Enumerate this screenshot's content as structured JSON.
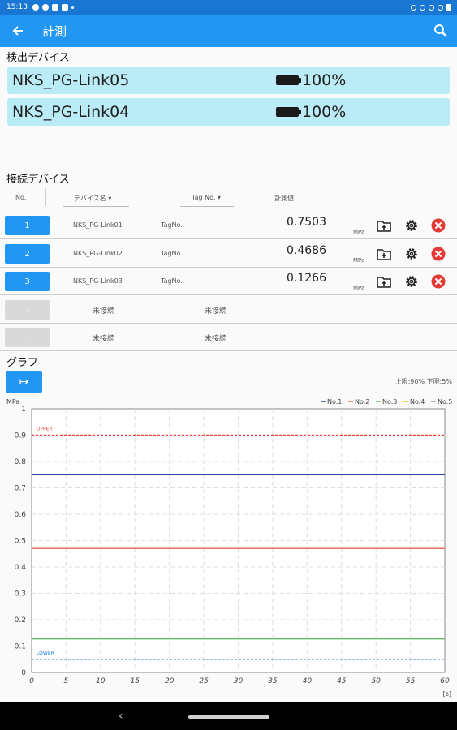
{
  "status_bar": {
    "time": "15:13"
  },
  "app_bar": {
    "title": "計測",
    "back_icon": "arrow-back-icon",
    "search_icon": "search-icon"
  },
  "detected": {
    "title": "検出デバイス",
    "devices": [
      {
        "name": "NKS_PG-Link05",
        "battery": "100%"
      },
      {
        "name": "NKS_PG-Link04",
        "battery": "100%"
      }
    ]
  },
  "connected": {
    "title": "接続デバイス",
    "headers": {
      "no": "No.",
      "device_name": "デバイス名",
      "tag_no": "Tag No.",
      "value": "計測値"
    },
    "rows": [
      {
        "no": "1",
        "name": "NKS_PG-Link01",
        "tag": "TagNo.",
        "value": "0.7503",
        "unit": "MPa"
      },
      {
        "no": "2",
        "name": "NKS_PG-Link02",
        "tag": "TagNo.",
        "value": "0.4686",
        "unit": "MPa"
      },
      {
        "no": "3",
        "name": "NKS_PG-Link03",
        "tag": "TagNo.",
        "value": "0.1266",
        "unit": "MPa"
      }
    ],
    "empty_rows": [
      {
        "no": "-",
        "name": "未接続",
        "tag": "未接続"
      },
      {
        "no": "-",
        "name": "未接続",
        "tag": "未接続"
      }
    ]
  },
  "graph": {
    "title": "グラフ",
    "button_label": "↦",
    "limits_text": "上限:90%  下限:5%"
  },
  "chart_data": {
    "type": "line",
    "ylabel": "MPa",
    "xlabel": "[s]",
    "xlim": [
      0,
      60
    ],
    "ylim": [
      0,
      1
    ],
    "xticks": [
      "0",
      "5",
      "10",
      "15",
      "20",
      "25",
      "30",
      "35",
      "40",
      "45",
      "50",
      "55",
      "60"
    ],
    "yticks": [
      "0",
      "0.1",
      "0.2",
      "0.3",
      "0.4",
      "0.5",
      "0.6",
      "0.7",
      "0.8",
      "0.9",
      "1"
    ],
    "grid": true,
    "legend_position": "top-right",
    "series": [
      {
        "name": "No.1",
        "color": "#2e3f9e",
        "x": [
          0,
          60
        ],
        "y": [
          0.75,
          0.75
        ]
      },
      {
        "name": "No.2",
        "color": "#f07060",
        "x": [
          0,
          60
        ],
        "y": [
          0.47,
          0.47
        ]
      },
      {
        "name": "No.3",
        "color": "#66bb6a",
        "x": [
          0,
          60
        ],
        "y": [
          0.127,
          0.127
        ]
      },
      {
        "name": "No.4",
        "color": "#fbc02d",
        "x": [],
        "y": []
      },
      {
        "name": "No.5",
        "color": "#9e9e9e",
        "x": [],
        "y": []
      }
    ],
    "thresholds": [
      {
        "label": "UPPER",
        "value": 0.9,
        "color": "#f44336"
      },
      {
        "label": "LOWER",
        "value": 0.05,
        "color": "#1e88e5"
      }
    ]
  }
}
